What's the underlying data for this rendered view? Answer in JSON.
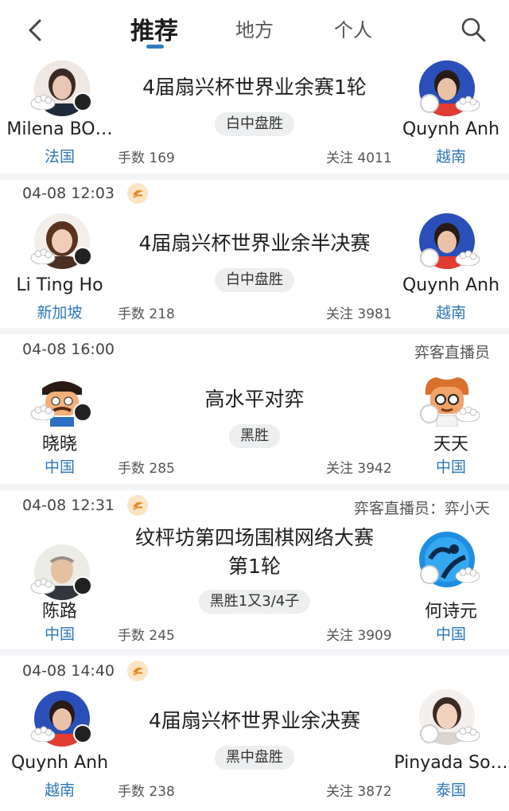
{
  "header": {
    "tabs": [
      {
        "label": "推荐",
        "active": true
      },
      {
        "label": "地方",
        "active": false
      },
      {
        "label": "个人",
        "active": false
      }
    ],
    "accent": "#2f7fc1"
  },
  "games": [
    {
      "date": "",
      "live": false,
      "broadcaster": "",
      "title": "4届扇兴杯世界业余赛1轮",
      "result": "白中盘胜",
      "moves": "手数 169",
      "follow": "关注 4011",
      "left": {
        "name": "Milena BO…",
        "country": "法国",
        "stone": "black"
      },
      "right": {
        "name": "Quynh Anh",
        "country": "越南",
        "stone": "white"
      }
    },
    {
      "date": "04-08 12:03",
      "live": true,
      "broadcaster": "",
      "title": "4届扇兴杯世界业余半决赛",
      "result": "白中盘胜",
      "moves": "手数 218",
      "follow": "关注 3981",
      "left": {
        "name": "Li Ting Ho",
        "country": "新加坡",
        "stone": "black"
      },
      "right": {
        "name": "Quynh Anh",
        "country": "越南",
        "stone": "white"
      }
    },
    {
      "date": "04-08 16:00",
      "live": false,
      "broadcaster": "弈客直播员",
      "title": "高水平对弈",
      "result": "黑胜",
      "moves": "手数 285",
      "follow": "关注 3942",
      "left": {
        "name": "晓晓",
        "country": "中国",
        "stone": "black"
      },
      "right": {
        "name": "天天",
        "country": "中国",
        "stone": "white"
      }
    },
    {
      "date": "04-08 12:31",
      "live": true,
      "broadcaster": "弈客直播员：弈小天",
      "title": "纹枰坊第四场围棋网络大赛第1轮",
      "title_line1": "纹枰坊第四场围棋网络大赛",
      "title_line2": "第1轮",
      "result": "黑胜1又3/4子",
      "moves": "手数 245",
      "follow": "关注 3909",
      "left": {
        "name": "陈路",
        "country": "中国",
        "stone": "black"
      },
      "right": {
        "name": "何诗元",
        "country": "中国",
        "stone": "white"
      }
    },
    {
      "date": "04-08 14:40",
      "live": true,
      "broadcaster": "",
      "title": "4届扇兴杯世界业余决赛",
      "result": "黑中盘胜",
      "moves": "手数 238",
      "follow": "关注 3872",
      "left": {
        "name": "Quynh Anh",
        "country": "越南",
        "stone": "black"
      },
      "right": {
        "name": "Pinyada So…",
        "country": "泰国",
        "stone": "white"
      }
    }
  ]
}
